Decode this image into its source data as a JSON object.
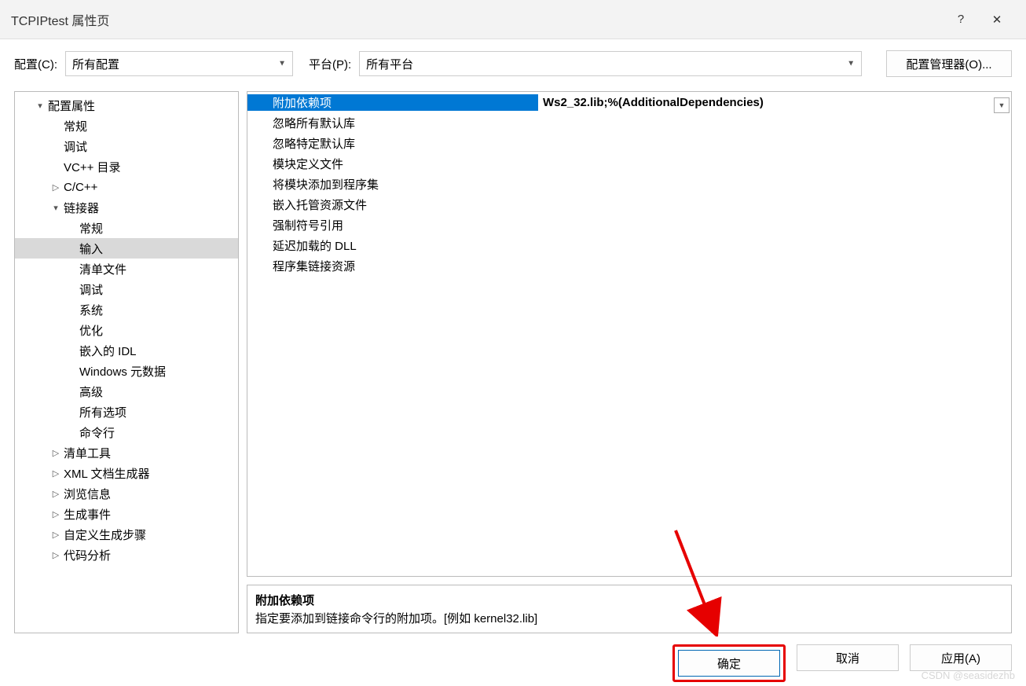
{
  "titlebar": {
    "title": "TCPIPtest 属性页",
    "help_icon": "?",
    "close_icon": "✕"
  },
  "config_bar": {
    "config_label": "配置(C):",
    "config_value": "所有配置",
    "platform_label": "平台(P):",
    "platform_value": "所有平台",
    "manager_btn": "配置管理器(O)..."
  },
  "tree": {
    "items": [
      {
        "label": "配置属性",
        "level": 1,
        "toggle": "▾"
      },
      {
        "label": "常规",
        "level": 2,
        "toggle": ""
      },
      {
        "label": "调试",
        "level": 2,
        "toggle": ""
      },
      {
        "label": "VC++ 目录",
        "level": 2,
        "toggle": ""
      },
      {
        "label": "C/C++",
        "level": 2,
        "toggle": "▷"
      },
      {
        "label": "链接器",
        "level": 2,
        "toggle": "▾"
      },
      {
        "label": "常规",
        "level": 3,
        "toggle": ""
      },
      {
        "label": "输入",
        "level": 3,
        "toggle": "",
        "selected": true
      },
      {
        "label": "清单文件",
        "level": 3,
        "toggle": ""
      },
      {
        "label": "调试",
        "level": 3,
        "toggle": ""
      },
      {
        "label": "系统",
        "level": 3,
        "toggle": ""
      },
      {
        "label": "优化",
        "level": 3,
        "toggle": ""
      },
      {
        "label": "嵌入的 IDL",
        "level": 3,
        "toggle": ""
      },
      {
        "label": "Windows 元数据",
        "level": 3,
        "toggle": ""
      },
      {
        "label": "高级",
        "level": 3,
        "toggle": ""
      },
      {
        "label": "所有选项",
        "level": 3,
        "toggle": ""
      },
      {
        "label": "命令行",
        "level": 3,
        "toggle": ""
      },
      {
        "label": "清单工具",
        "level": 2,
        "toggle": "▷"
      },
      {
        "label": "XML 文档生成器",
        "level": 2,
        "toggle": "▷"
      },
      {
        "label": "浏览信息",
        "level": 2,
        "toggle": "▷"
      },
      {
        "label": "生成事件",
        "level": 2,
        "toggle": "▷"
      },
      {
        "label": "自定义生成步骤",
        "level": 2,
        "toggle": "▷"
      },
      {
        "label": "代码分析",
        "level": 2,
        "toggle": "▷"
      }
    ]
  },
  "grid": {
    "rows": [
      {
        "name": "附加依赖项",
        "value": "Ws2_32.lib;%(AdditionalDependencies)",
        "selected": true,
        "dropdown": true
      },
      {
        "name": "忽略所有默认库",
        "value": ""
      },
      {
        "name": "忽略特定默认库",
        "value": ""
      },
      {
        "name": "模块定义文件",
        "value": ""
      },
      {
        "name": "将模块添加到程序集",
        "value": ""
      },
      {
        "name": "嵌入托管资源文件",
        "value": ""
      },
      {
        "name": "强制符号引用",
        "value": ""
      },
      {
        "name": "延迟加载的 DLL",
        "value": ""
      },
      {
        "name": "程序集链接资源",
        "value": ""
      }
    ]
  },
  "description": {
    "title": "附加依赖项",
    "text": "指定要添加到链接命令行的附加项。[例如 kernel32.lib]"
  },
  "footer": {
    "ok": "确定",
    "cancel": "取消",
    "apply": "应用(A)"
  },
  "watermark": "CSDN @seasidezhb"
}
